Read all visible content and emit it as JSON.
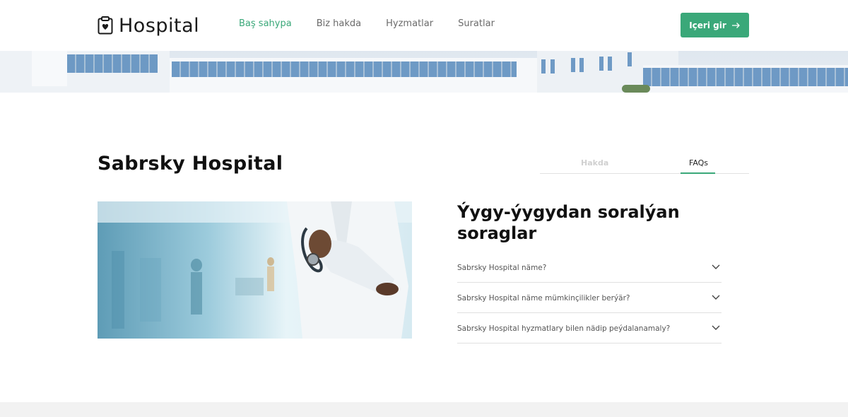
{
  "brand": {
    "name": "Hospital",
    "icon": "clipboard-heart-icon"
  },
  "nav": {
    "items": [
      {
        "label": "Baş sahypa",
        "active": true
      },
      {
        "label": "Biz hakda",
        "active": false
      },
      {
        "label": "Hyzmatlar",
        "active": false
      },
      {
        "label": "Suratlar",
        "active": false
      }
    ]
  },
  "login": {
    "label": "Içeri gir",
    "icon": "arrow-right-icon"
  },
  "main": {
    "title": "Sabrsky Hospital",
    "tabs": [
      {
        "label": "Hakda",
        "active": false
      },
      {
        "label": "FAQs",
        "active": true
      }
    ]
  },
  "faq": {
    "title": "Ýygy-ýygydan soralýan soraglar",
    "items": [
      {
        "question": "Sabrsky Hospital näme?"
      },
      {
        "question": "Sabrsky Hospital näme mümkinçilikler berýär?"
      },
      {
        "question": "Sabrsky Hospital hyzmatlary bilen nädip peýdalanamaly?"
      }
    ]
  },
  "colors": {
    "accent": "#3aa879",
    "text": "#111111",
    "muted": "#6b6b6b",
    "footer": "#f2f2f2"
  }
}
